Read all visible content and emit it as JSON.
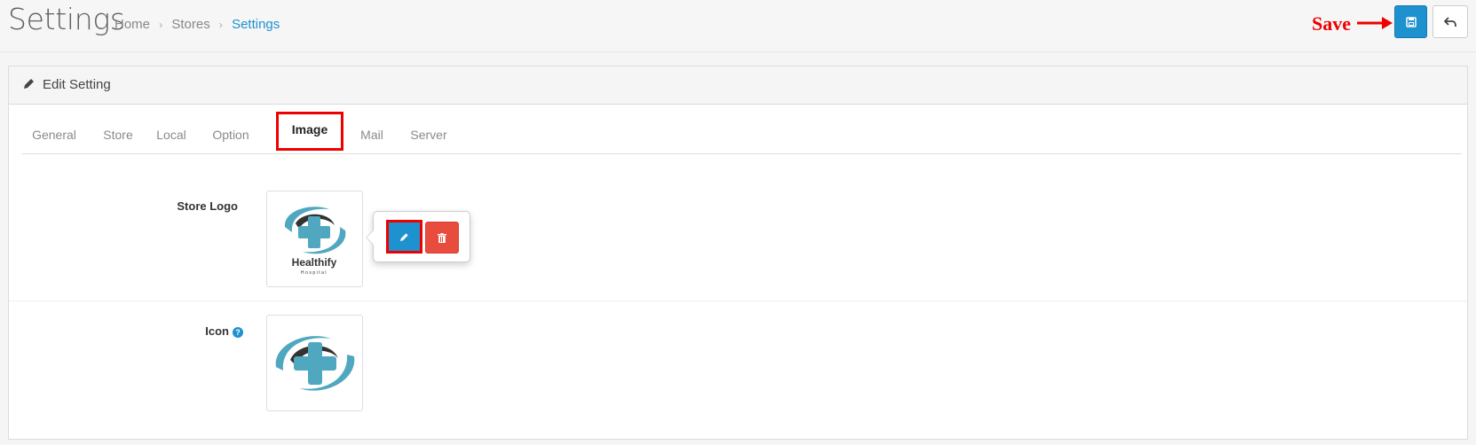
{
  "header": {
    "title": "Settings",
    "breadcrumb": [
      "Home",
      "Stores",
      "Settings"
    ]
  },
  "annotation": {
    "save_label": "Save"
  },
  "panel": {
    "title": "Edit Setting",
    "tabs": [
      "General",
      "Store",
      "Local",
      "Option",
      "Image",
      "Mail",
      "Server"
    ],
    "active_tab": "Image"
  },
  "fields": {
    "store_logo": {
      "label": "Store Logo",
      "logo_brand": "Healthify",
      "logo_sub": "Hospital"
    },
    "icon": {
      "label": "Icon",
      "help": "?"
    }
  },
  "colors": {
    "primary": "#1e91cf",
    "danger": "#e74c3c",
    "annotation": "#ee0000",
    "logo_teal": "#4fa8bf",
    "logo_dark": "#333333"
  }
}
